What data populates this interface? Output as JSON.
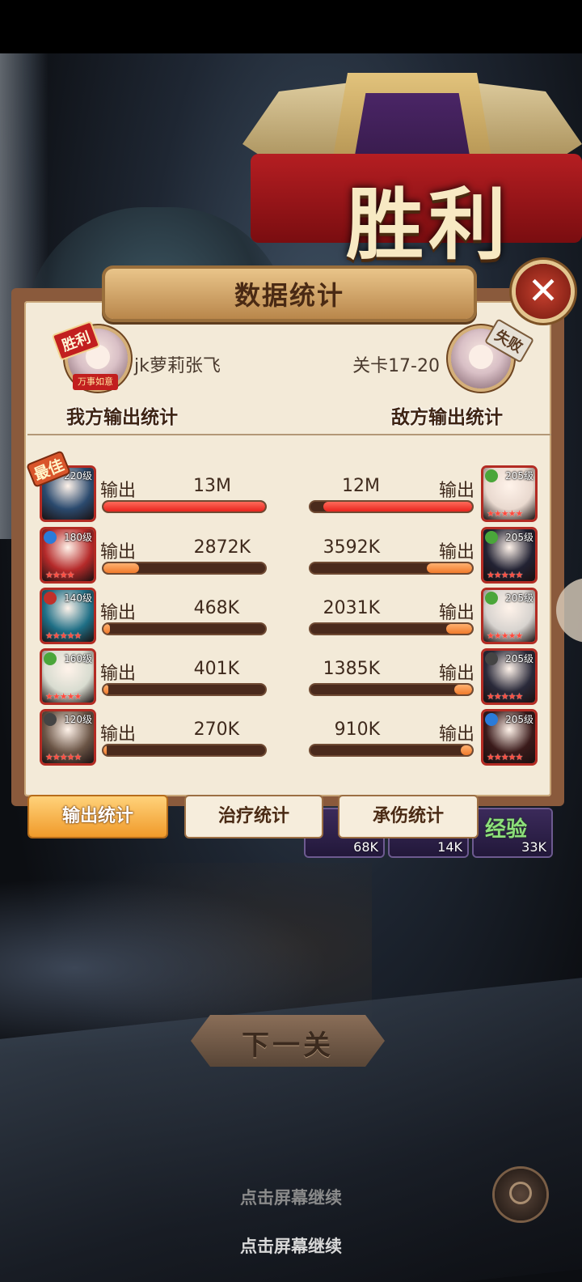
{
  "victory_banner": "胜利",
  "dialog": {
    "title": "数据统计",
    "close_symbol": "✕"
  },
  "player": {
    "name": "jk萝莉张飞",
    "win_tag": "胜利",
    "banner": "万事如意",
    "side_label": "我方输出统计"
  },
  "enemy": {
    "stage": "关卡17-20",
    "lose_tag": "失败",
    "side_label": "敌方输出统计"
  },
  "best_tag": "最佳",
  "rows": [
    {
      "left": {
        "level": "220级",
        "stars": "",
        "label": "输出",
        "value": "13M",
        "fraction": 1.0,
        "art": "#2b4a6e",
        "elem": ""
      },
      "right": {
        "level": "205级",
        "stars": "★★★★★",
        "label": "输出",
        "value": "12M",
        "fraction": 0.92,
        "art": "#e9d9cf",
        "elem": "#4aa63a"
      }
    },
    {
      "left": {
        "level": "180级",
        "stars": "★★★★",
        "label": "输出",
        "value": "2872K",
        "fraction": 0.22,
        "art": "#b52a2a",
        "elem": "#2a7bd9"
      },
      "right": {
        "level": "205级",
        "stars": "★★★★★",
        "label": "输出",
        "value": "3592K",
        "fraction": 0.28,
        "art": "#222233",
        "elem": "#4aa63a"
      }
    },
    {
      "left": {
        "level": "140级",
        "stars": "★★★★★",
        "label": "输出",
        "value": "468K",
        "fraction": 0.04,
        "art": "#1f6f86",
        "elem": "#c0302a"
      },
      "right": {
        "level": "205级",
        "stars": "★★★★★",
        "label": "输出",
        "value": "2031K",
        "fraction": 0.16,
        "art": "#d7d3cf",
        "elem": "#4aa63a"
      }
    },
    {
      "left": {
        "level": "160级",
        "stars": "★★★★★",
        "label": "输出",
        "value": "401K",
        "fraction": 0.03,
        "art": "#d8dcd0",
        "elem": "#4aa63a"
      },
      "right": {
        "level": "205级",
        "stars": "★★★★★",
        "label": "输出",
        "value": "1385K",
        "fraction": 0.11,
        "art": "#2a2a3a",
        "elem": "#444"
      }
    },
    {
      "left": {
        "level": "120级",
        "stars": "★★★★★",
        "label": "输出",
        "value": "270K",
        "fraction": 0.02,
        "art": "#6b5546",
        "elem": "#444"
      },
      "right": {
        "level": "205级",
        "stars": "★★★★★",
        "label": "输出",
        "value": "910K",
        "fraction": 0.07,
        "art": "#3a1a1a",
        "elem": "#2a7bd9"
      }
    }
  ],
  "tabs": [
    {
      "label": "输出统计",
      "active": true
    },
    {
      "label": "治疗统计",
      "active": false
    },
    {
      "label": "承伤统计",
      "active": false
    }
  ],
  "rewards": [
    {
      "amount": "68K",
      "label": ""
    },
    {
      "amount": "14K",
      "label": ""
    },
    {
      "amount": "33K",
      "label": "经验"
    }
  ],
  "next_button": "下一关",
  "tap_hint_faint": "点击屏幕继续",
  "tap_hint": "点击屏幕继续"
}
